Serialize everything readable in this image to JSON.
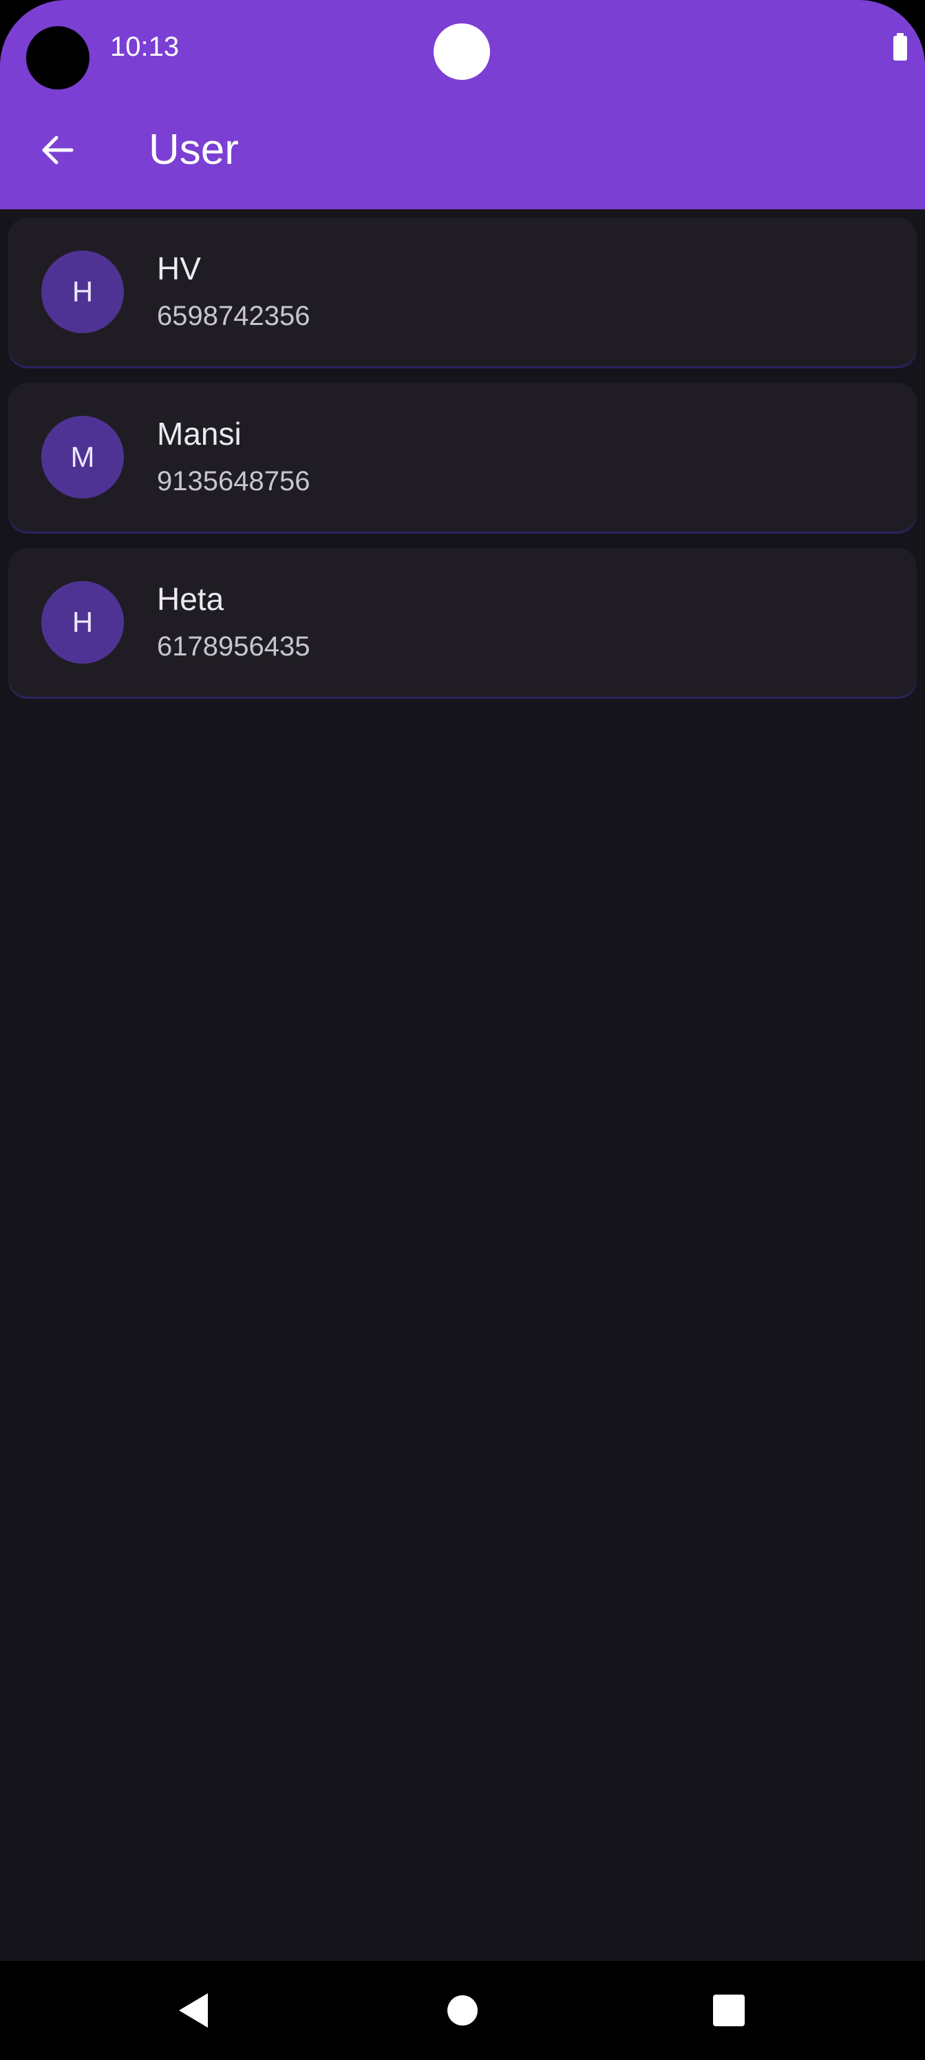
{
  "status_bar": {
    "time": "10:13"
  },
  "app_bar": {
    "title": "User",
    "back_icon": "arrow-left-icon",
    "color": "#7b3fd3"
  },
  "users": [
    {
      "initial": "H",
      "name": "HV",
      "phone": "6598742356"
    },
    {
      "initial": "M",
      "name": "Mansi",
      "phone": "9135648756"
    },
    {
      "initial": "H",
      "name": "Heta",
      "phone": "6178956435"
    }
  ],
  "nav_bar": {
    "back_icon": "triangle-back-icon",
    "home_icon": "circle-home-icon",
    "recents_icon": "square-recents-icon"
  },
  "theme": {
    "background": "#16141b",
    "card": "#1f1d23",
    "avatar": "#4f3394"
  }
}
